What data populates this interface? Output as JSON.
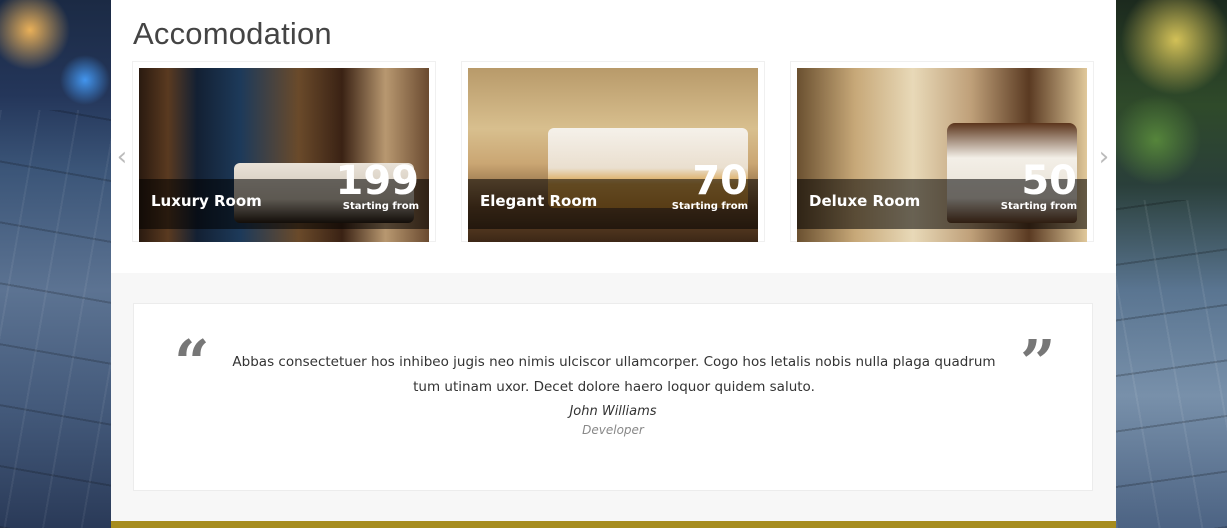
{
  "section": {
    "title": "Accomodation"
  },
  "rooms": [
    {
      "name": "Luxury Room",
      "price": "199",
      "sub": "Starting from",
      "icon": "luxury-room-photo"
    },
    {
      "name": "Elegant Room",
      "price": "70",
      "sub": "Starting from",
      "icon": "elegant-room-photo"
    },
    {
      "name": "Deluxe Room",
      "price": "50",
      "sub": "Starting from",
      "icon": "deluxe-room-photo"
    }
  ],
  "carousel": {
    "prev": "‹",
    "next": "›"
  },
  "testimonial": {
    "open_quote": "“",
    "close_quote": "”",
    "text": "Abbas consectetuer hos inhibeo jugis neo nimis ulciscor ullamcorper. Cogo hos letalis nobis nulla plaga quadrum tum utinam uxor. Decet dolore haero loquor quidem saluto.",
    "author": "John Williams",
    "role": "Developer"
  },
  "colors": {
    "accent_bar": "#a68c1e",
    "title": "#444444"
  }
}
